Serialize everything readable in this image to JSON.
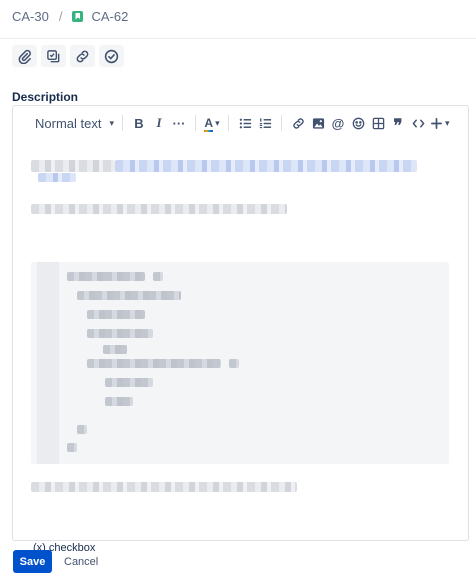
{
  "breadcrumb": {
    "parent": "CA-30",
    "separator": "/",
    "current": "CA-62"
  },
  "actions": [
    {
      "name": "attach-button",
      "icon": "paperclip-icon"
    },
    {
      "name": "child-issue-button",
      "icon": "subtask-icon"
    },
    {
      "name": "link-issue-button",
      "icon": "link-icon"
    },
    {
      "name": "status-button",
      "icon": "check-circle-icon"
    }
  ],
  "description": {
    "label": "Description"
  },
  "toolbar": {
    "text_style": "Normal text",
    "bold": "B",
    "italic": "I",
    "more": "···",
    "text_color": "A"
  },
  "editor": {
    "checkbox_text": "(x) checkbox"
  },
  "footer": {
    "save_label": "Save",
    "cancel_label": "Cancel"
  },
  "colors": {
    "primary": "#0052cc",
    "story_icon": "#36b37e",
    "text": "#172b4d"
  }
}
